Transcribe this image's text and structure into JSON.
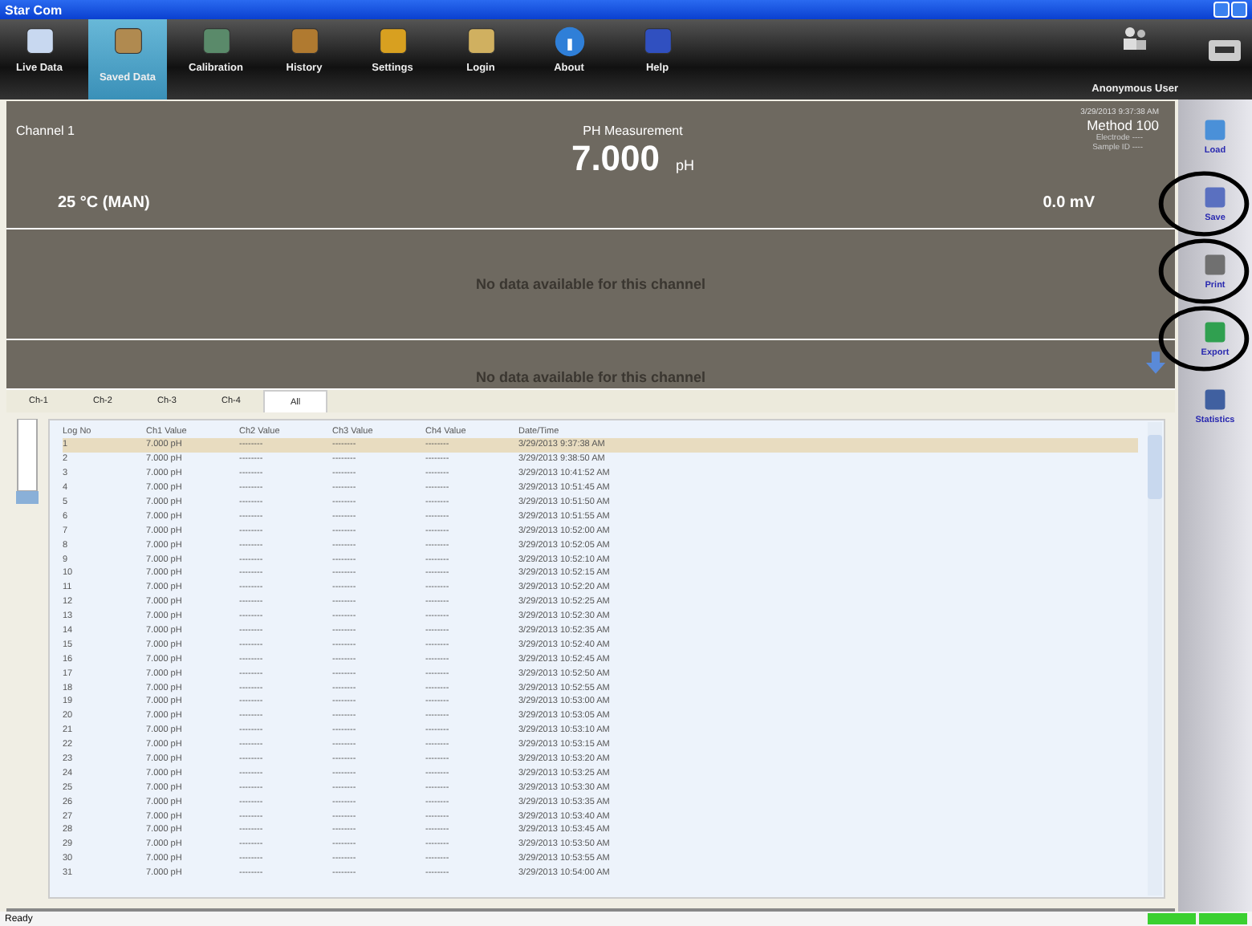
{
  "window": {
    "title": "Star Com"
  },
  "toolbar": [
    {
      "label": "Live Data",
      "selected": false
    },
    {
      "label": "Saved Data",
      "selected": true
    },
    {
      "label": "Calibration",
      "selected": false
    },
    {
      "label": "History",
      "selected": false
    },
    {
      "label": "Settings",
      "selected": false
    },
    {
      "label": "Login",
      "selected": false
    },
    {
      "label": "About",
      "selected": false
    },
    {
      "label": "Help",
      "selected": false
    }
  ],
  "user": "Anonymous User",
  "measurement": {
    "channel": "Channel 1",
    "title": "PH Measurement",
    "value": "7.000",
    "unit": "pH",
    "temperature": "25 °C (MAN)",
    "mv": "0.0 mV",
    "timestamp": "3/29/2013 9:37:38 AM",
    "method": "Method 100",
    "electrode": "Electrode ----",
    "sample_id": "Sample ID ----"
  },
  "no_data": [
    "No data available for this channel",
    "No data available for this channel"
  ],
  "tabs": [
    {
      "label": "Ch-1",
      "selected": false
    },
    {
      "label": "Ch-2",
      "selected": false
    },
    {
      "label": "Ch-3",
      "selected": false
    },
    {
      "label": "Ch-4",
      "selected": false
    },
    {
      "label": "All",
      "selected": true
    }
  ],
  "table": {
    "columns": [
      "Log No",
      "Ch1 Value",
      "Ch2 Value",
      "Ch3 Value",
      "Ch4 Value",
      "Date/Time"
    ],
    "rows": [
      {
        "selected": true,
        "cells": [
          "1",
          "7.000 pH",
          "--------",
          "--------",
          "--------",
          "3/29/2013 9:37:38 AM"
        ]
      },
      {
        "selected": false,
        "cells": [
          "2",
          "7.000 pH",
          "--------",
          "--------",
          "--------",
          "3/29/2013 9:38:50 AM"
        ]
      },
      {
        "selected": false,
        "cells": [
          "3",
          "7.000 pH",
          "--------",
          "--------",
          "--------",
          "3/29/2013 10:41:52 AM"
        ]
      },
      {
        "selected": false,
        "cells": [
          "4",
          "7.000 pH",
          "--------",
          "--------",
          "--------",
          "3/29/2013 10:51:45 AM"
        ]
      },
      {
        "selected": false,
        "cells": [
          "5",
          "7.000 pH",
          "--------",
          "--------",
          "--------",
          "3/29/2013 10:51:50 AM"
        ]
      },
      {
        "selected": false,
        "cells": [
          "6",
          "7.000 pH",
          "--------",
          "--------",
          "--------",
          "3/29/2013 10:51:55 AM"
        ]
      },
      {
        "selected": false,
        "cells": [
          "7",
          "7.000 pH",
          "--------",
          "--------",
          "--------",
          "3/29/2013 10:52:00 AM"
        ]
      },
      {
        "selected": false,
        "cells": [
          "8",
          "7.000 pH",
          "--------",
          "--------",
          "--------",
          "3/29/2013 10:52:05 AM"
        ]
      },
      {
        "selected": false,
        "cells": [
          "9",
          "7.000 pH",
          "--------",
          "--------",
          "--------",
          "3/29/2013 10:52:10 AM"
        ]
      },
      {
        "selected": false,
        "cells": [
          "10",
          "7.000 pH",
          "--------",
          "--------",
          "--------",
          "3/29/2013 10:52:15 AM"
        ]
      },
      {
        "selected": false,
        "cells": [
          "11",
          "7.000 pH",
          "--------",
          "--------",
          "--------",
          "3/29/2013 10:52:20 AM"
        ]
      },
      {
        "selected": false,
        "cells": [
          "12",
          "7.000 pH",
          "--------",
          "--------",
          "--------",
          "3/29/2013 10:52:25 AM"
        ]
      },
      {
        "selected": false,
        "cells": [
          "13",
          "7.000 pH",
          "--------",
          "--------",
          "--------",
          "3/29/2013 10:52:30 AM"
        ]
      },
      {
        "selected": false,
        "cells": [
          "14",
          "7.000 pH",
          "--------",
          "--------",
          "--------",
          "3/29/2013 10:52:35 AM"
        ]
      },
      {
        "selected": false,
        "cells": [
          "15",
          "7.000 pH",
          "--------",
          "--------",
          "--------",
          "3/29/2013 10:52:40 AM"
        ]
      },
      {
        "selected": false,
        "cells": [
          "16",
          "7.000 pH",
          "--------",
          "--------",
          "--------",
          "3/29/2013 10:52:45 AM"
        ]
      },
      {
        "selected": false,
        "cells": [
          "17",
          "7.000 pH",
          "--------",
          "--------",
          "--------",
          "3/29/2013 10:52:50 AM"
        ]
      },
      {
        "selected": false,
        "cells": [
          "18",
          "7.000 pH",
          "--------",
          "--------",
          "--------",
          "3/29/2013 10:52:55 AM"
        ]
      },
      {
        "selected": false,
        "cells": [
          "19",
          "7.000 pH",
          "--------",
          "--------",
          "--------",
          "3/29/2013 10:53:00 AM"
        ]
      },
      {
        "selected": false,
        "cells": [
          "20",
          "7.000 pH",
          "--------",
          "--------",
          "--------",
          "3/29/2013 10:53:05 AM"
        ]
      },
      {
        "selected": false,
        "cells": [
          "21",
          "7.000 pH",
          "--------",
          "--------",
          "--------",
          "3/29/2013 10:53:10 AM"
        ]
      },
      {
        "selected": false,
        "cells": [
          "22",
          "7.000 pH",
          "--------",
          "--------",
          "--------",
          "3/29/2013 10:53:15 AM"
        ]
      },
      {
        "selected": false,
        "cells": [
          "23",
          "7.000 pH",
          "--------",
          "--------",
          "--------",
          "3/29/2013 10:53:20 AM"
        ]
      },
      {
        "selected": false,
        "cells": [
          "24",
          "7.000 pH",
          "--------",
          "--------",
          "--------",
          "3/29/2013 10:53:25 AM"
        ]
      },
      {
        "selected": false,
        "cells": [
          "25",
          "7.000 pH",
          "--------",
          "--------",
          "--------",
          "3/29/2013 10:53:30 AM"
        ]
      },
      {
        "selected": false,
        "cells": [
          "26",
          "7.000 pH",
          "--------",
          "--------",
          "--------",
          "3/29/2013 10:53:35 AM"
        ]
      },
      {
        "selected": false,
        "cells": [
          "27",
          "7.000 pH",
          "--------",
          "--------",
          "--------",
          "3/29/2013 10:53:40 AM"
        ]
      },
      {
        "selected": false,
        "cells": [
          "28",
          "7.000 pH",
          "--------",
          "--------",
          "--------",
          "3/29/2013 10:53:45 AM"
        ]
      },
      {
        "selected": false,
        "cells": [
          "29",
          "7.000 pH",
          "--------",
          "--------",
          "--------",
          "3/29/2013 10:53:50 AM"
        ]
      },
      {
        "selected": false,
        "cells": [
          "30",
          "7.000 pH",
          "--------",
          "--------",
          "--------",
          "3/29/2013 10:53:55 AM"
        ]
      },
      {
        "selected": false,
        "cells": [
          "31",
          "7.000 pH",
          "--------",
          "--------",
          "--------",
          "3/29/2013 10:54:00 AM"
        ]
      }
    ]
  },
  "side_buttons": [
    {
      "label": "Load",
      "circled": false
    },
    {
      "label": "Save",
      "circled": true
    },
    {
      "label": "Print",
      "circled": true
    },
    {
      "label": "Export",
      "circled": true
    },
    {
      "label": "Statistics",
      "circled": false
    }
  ],
  "status_bar": {
    "text": "Ready"
  }
}
